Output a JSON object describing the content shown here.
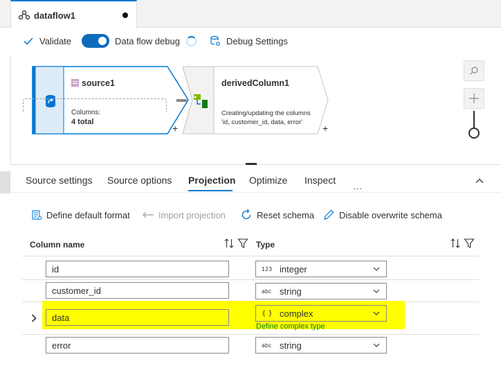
{
  "tab": {
    "title": "dataflow1"
  },
  "toolbar": {
    "validate": "Validate",
    "debug_toggle": "Data flow debug",
    "debug_settings": "Debug Settings"
  },
  "canvas": {
    "source_node": {
      "title": "source1",
      "columns_label": "Columns:",
      "columns_value": "4 total",
      "plus": "+"
    },
    "derived_node": {
      "title": "derivedColumn1",
      "desc_line1": "Creating/updating the columns",
      "desc_line2": "'id, customer_id, data, error'",
      "plus": "+"
    }
  },
  "settings_tabs": [
    "Source settings",
    "Source options",
    "Projection",
    "Optimize",
    "Inspect"
  ],
  "active_tab": "Projection",
  "more": "...",
  "actions": {
    "define_format": "Define default format",
    "import_projection": "Import projection",
    "reset_schema": "Reset schema",
    "disable_overwrite": "Disable overwrite schema"
  },
  "table": {
    "col_name_header": "Column name",
    "type_header": "Type",
    "rows": [
      {
        "name": "id",
        "type_icon": "123",
        "type": "integer"
      },
      {
        "name": "customer_id",
        "type_icon": "abc",
        "type": "string"
      },
      {
        "name": "data",
        "type_icon": "{ }",
        "type": "complex",
        "link": "Define complex type"
      },
      {
        "name": "error",
        "type_icon": "abc",
        "type": "string"
      }
    ]
  },
  "colors": {
    "accent": "#0078d4",
    "highlight": "#ffff00",
    "link_green": "#107c10"
  }
}
